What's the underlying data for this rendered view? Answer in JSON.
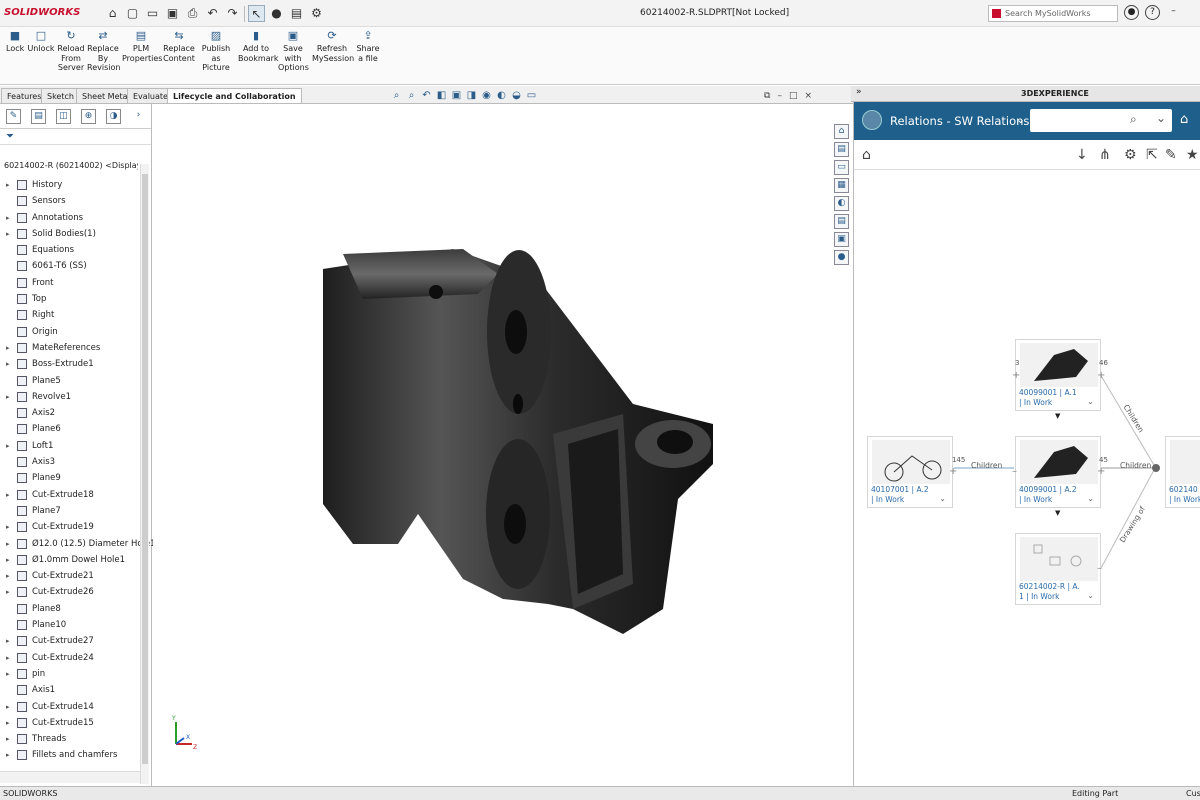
{
  "app": {
    "logo": "SOLIDWORKS",
    "document_title": "60214002-R.SLDPRT[Not Locked]",
    "search_placeholder": "Search MySolidWorks"
  },
  "ribbon": {
    "buttons": [
      {
        "label": "Lock",
        "icon": "lock-icon"
      },
      {
        "label": "Unlock",
        "icon": "unlock-icon"
      },
      {
        "label": "Reload From Server",
        "icon": "reload-icon"
      },
      {
        "label": "Replace By Revision",
        "icon": "replace-revision-icon"
      },
      {
        "label": "PLM Properties",
        "icon": "plm-properties-icon"
      },
      {
        "label": "Replace Content",
        "icon": "replace-content-icon"
      },
      {
        "label": "Publish as Picture",
        "icon": "publish-picture-icon"
      },
      {
        "label": "Add to Bookmark",
        "icon": "bookmark-icon"
      },
      {
        "label": "Save with Options",
        "icon": "save-options-icon"
      },
      {
        "label": "Refresh MySession",
        "icon": "refresh-icon"
      },
      {
        "label": "Share a file",
        "icon": "share-icon"
      }
    ]
  },
  "tabs": [
    "Features",
    "Sketch",
    "Sheet Metal",
    "Evaluate",
    "Lifecycle and Collaboration"
  ],
  "active_tab": "Lifecycle and Collaboration",
  "panel": {
    "title": "3DEXPERIENCE"
  },
  "feature_tree": {
    "root": "60214002-R (60214002) <Display St...",
    "items": [
      {
        "label": "History",
        "expandable": true
      },
      {
        "label": "Sensors",
        "expandable": false
      },
      {
        "label": "Annotations",
        "expandable": true
      },
      {
        "label": "Solid Bodies(1)",
        "expandable": true
      },
      {
        "label": "Equations",
        "expandable": false
      },
      {
        "label": "6061-T6 (SS)",
        "expandable": false
      },
      {
        "label": "Front",
        "expandable": false
      },
      {
        "label": "Top",
        "expandable": false
      },
      {
        "label": "Right",
        "expandable": false
      },
      {
        "label": "Origin",
        "expandable": false
      },
      {
        "label": "MateReferences",
        "expandable": true
      },
      {
        "label": "Boss-Extrude1",
        "expandable": true
      },
      {
        "label": "Plane5",
        "expandable": false
      },
      {
        "label": "Revolve1",
        "expandable": true
      },
      {
        "label": "Axis2",
        "expandable": false
      },
      {
        "label": "Plane6",
        "expandable": false
      },
      {
        "label": "Loft1",
        "expandable": true
      },
      {
        "label": "Axis3",
        "expandable": false
      },
      {
        "label": "Plane9",
        "expandable": false
      },
      {
        "label": "Cut-Extrude18",
        "expandable": true
      },
      {
        "label": "Plane7",
        "expandable": false
      },
      {
        "label": "Cut-Extrude19",
        "expandable": true
      },
      {
        "label": "Ø12.0 (12.5) Diameter Hole1",
        "expandable": true
      },
      {
        "label": "Ø1.0mm Dowel Hole1",
        "expandable": true
      },
      {
        "label": "Cut-Extrude21",
        "expandable": true
      },
      {
        "label": "Cut-Extrude26",
        "expandable": true
      },
      {
        "label": "Plane8",
        "expandable": false
      },
      {
        "label": "Plane10",
        "expandable": false
      },
      {
        "label": "Cut-Extrude27",
        "expandable": true
      },
      {
        "label": "Cut-Extrude24",
        "expandable": true
      },
      {
        "label": "pin",
        "expandable": true
      },
      {
        "label": "Axis1",
        "expandable": false
      },
      {
        "label": "Cut-Extrude14",
        "expandable": true
      },
      {
        "label": "Cut-Extrude15",
        "expandable": true
      },
      {
        "label": "Threads",
        "expandable": true
      },
      {
        "label": "Fillets and chamfers",
        "expandable": true
      }
    ]
  },
  "relations": {
    "title": "Relations - SW Relations...",
    "nodes": [
      {
        "name": "40099001 | A.1",
        "state": "| In Work"
      },
      {
        "name": "40107001 | A.2",
        "state": "| In Work"
      },
      {
        "name": "40099001 | A.2",
        "state": "| In Work"
      },
      {
        "name": "60214002-R | A.",
        "state": "1 | In Work"
      },
      {
        "name": "602140",
        "state": "| In Work"
      }
    ],
    "counts": [
      "3",
      "46",
      "145",
      "45"
    ],
    "edge_labels": [
      "Children",
      "Children",
      "Children",
      "Drawing of"
    ]
  },
  "triad": {
    "y": "Y",
    "x": "X",
    "z": "Z"
  },
  "status": {
    "app": "SOLIDWORKS",
    "mode": "Editing Part",
    "custom": "Cus"
  }
}
